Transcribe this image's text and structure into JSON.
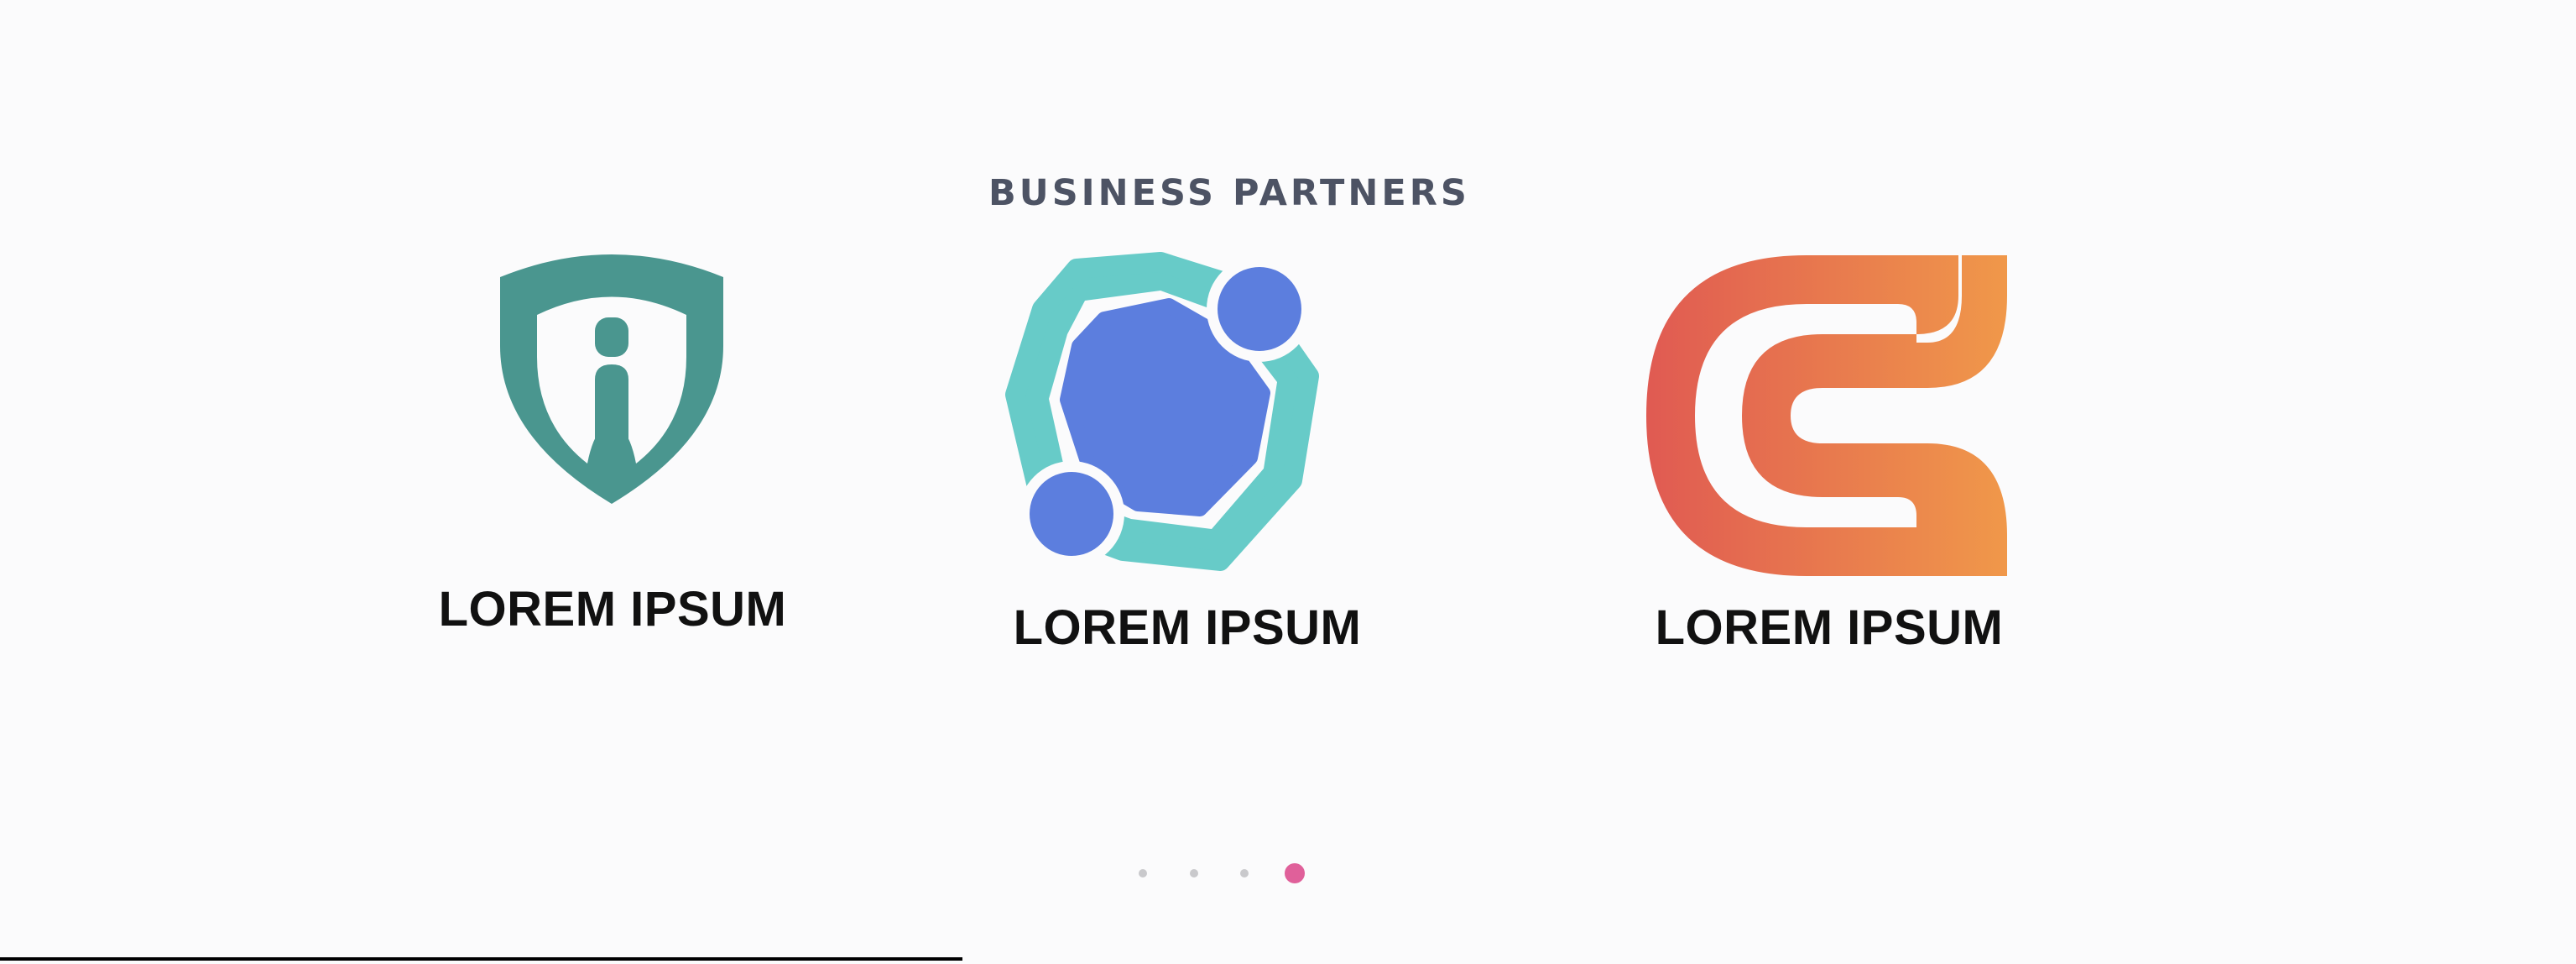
{
  "section": {
    "title": "BUSINESS PARTNERS"
  },
  "partners": [
    {
      "name": "LOREM IPSUM",
      "icon": "shield-i-icon",
      "color": "#4a968f"
    },
    {
      "name": "LOREM IPSUM",
      "icon": "hexagon-nodes-icon",
      "colors": [
        "#67cbc8",
        "#5c7ede"
      ]
    },
    {
      "name": "LOREM IPSUM",
      "icon": "letter-c-icon",
      "colors": [
        "#e05a52",
        "#f0984a"
      ]
    }
  ],
  "carousel": {
    "slide_count": 4,
    "active_index": 3,
    "active_color": "#e0609a",
    "inactive_color": "#c9c9cc"
  }
}
